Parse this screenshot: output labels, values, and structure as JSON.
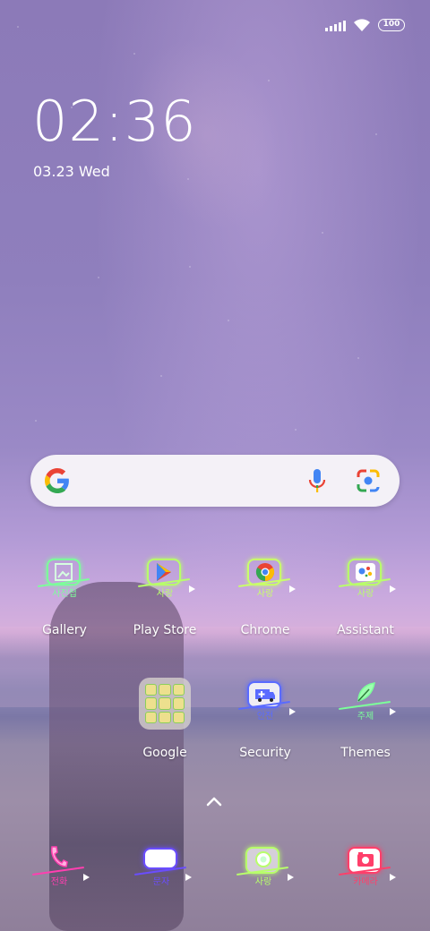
{
  "status_bar": {
    "battery": "100"
  },
  "lock": {
    "time": "02:36",
    "date": "03.23 Wed"
  },
  "search": {
    "icons": [
      "google-logo",
      "mic-icon",
      "lens-icon"
    ]
  },
  "apps": [
    {
      "label": "Gallery",
      "tag": "사진첩",
      "neon": "#7cff9a",
      "glyph": "image"
    },
    {
      "label": "Play Store",
      "tag": "사랑",
      "neon": "#b8ff6a",
      "glyph": "play"
    },
    {
      "label": "Chrome",
      "tag": "사랑",
      "neon": "#c9ff6a",
      "glyph": "chrome"
    },
    {
      "label": "Assistant",
      "tag": "사랑",
      "neon": "#b9ff6a",
      "glyph": "assistant"
    },
    {
      "label": "Google",
      "tag": "",
      "neon": "#8bcf5a",
      "glyph": "folder"
    },
    {
      "label": "Security",
      "tag": "안전",
      "neon": "#5a6bff",
      "glyph": "ambulance"
    },
    {
      "label": "Themes",
      "tag": "주제",
      "neon": "#7cff9a",
      "glyph": "feather"
    }
  ],
  "dock": [
    {
      "tag": "전화",
      "neon": "#ff3fb0",
      "glyph": "phone"
    },
    {
      "tag": "문자",
      "neon": "#6a4dff",
      "glyph": "message"
    },
    {
      "tag": "사랑",
      "neon": "#b8ff6a",
      "glyph": "camera-round"
    },
    {
      "tag": "카메라",
      "neon": "#ff3f6a",
      "glyph": "camera"
    }
  ],
  "colors": {
    "search_bg": "#f4f1f7",
    "google_blue": "#4285F4",
    "google_red": "#EA4335",
    "google_yellow": "#FBBC05",
    "google_green": "#34A853"
  }
}
